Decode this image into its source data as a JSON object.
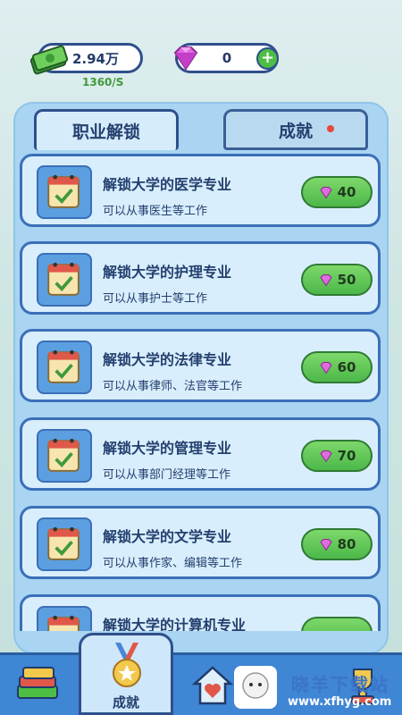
{
  "header": {
    "money": "2.94万",
    "money_rate": "1360/S",
    "gems": "0"
  },
  "tabs": [
    {
      "label": "职业解锁",
      "active": true
    },
    {
      "label": "成就",
      "active": false,
      "has_notification": true
    }
  ],
  "unlock_list": [
    {
      "title": "解锁大学的医学专业",
      "subtitle": "可以从事医生等工作",
      "cost": "40"
    },
    {
      "title": "解锁大学的护理专业",
      "subtitle": "可以从事护士等工作",
      "cost": "50"
    },
    {
      "title": "解锁大学的法律专业",
      "subtitle": "可以从事律师、法官等工作",
      "cost": "60"
    },
    {
      "title": "解锁大学的管理专业",
      "subtitle": "可以从事部门经理等工作",
      "cost": "70"
    },
    {
      "title": "解锁大学的文学专业",
      "subtitle": "可以从事作家、编辑等工作",
      "cost": "80"
    },
    {
      "title": "解锁大学的计算机专业",
      "subtitle": "",
      "cost": ""
    }
  ],
  "bottom_nav": {
    "selected_label": "成就"
  },
  "watermark": {
    "text": "晓羊下载站",
    "url": "www.xfhyg.com"
  },
  "colors": {
    "accent_blue": "#3f86d4",
    "panel": "#a9d5f2",
    "card": "#d9eefc",
    "price_green": "#4cb84a",
    "gem_pink": "#d94bd6",
    "cash_green": "#3f9a3a"
  },
  "icons": [
    "cash-stack-icon",
    "gem-icon",
    "plus-icon",
    "calendar-check-icon",
    "book-icon",
    "medal-icon",
    "home-heart-icon",
    "sheep-icon",
    "trophy-icon"
  ]
}
